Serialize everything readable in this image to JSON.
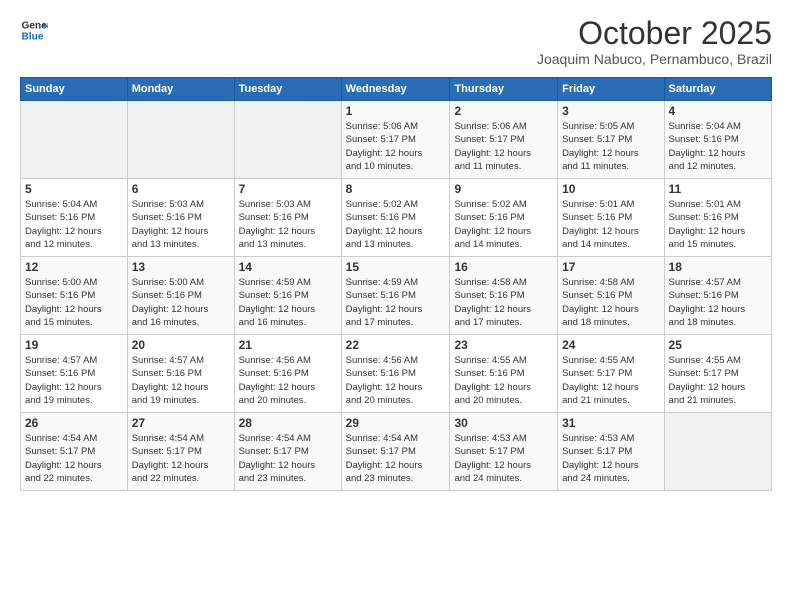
{
  "logo": {
    "line1": "General",
    "line2": "Blue"
  },
  "title": "October 2025",
  "subtitle": "Joaquim Nabuco, Pernambuco, Brazil",
  "days_header": [
    "Sunday",
    "Monday",
    "Tuesday",
    "Wednesday",
    "Thursday",
    "Friday",
    "Saturday"
  ],
  "weeks": [
    [
      {
        "day": "",
        "info": ""
      },
      {
        "day": "",
        "info": ""
      },
      {
        "day": "",
        "info": ""
      },
      {
        "day": "1",
        "info": "Sunrise: 5:06 AM\nSunset: 5:17 PM\nDaylight: 12 hours\nand 10 minutes."
      },
      {
        "day": "2",
        "info": "Sunrise: 5:06 AM\nSunset: 5:17 PM\nDaylight: 12 hours\nand 11 minutes."
      },
      {
        "day": "3",
        "info": "Sunrise: 5:05 AM\nSunset: 5:17 PM\nDaylight: 12 hours\nand 11 minutes."
      },
      {
        "day": "4",
        "info": "Sunrise: 5:04 AM\nSunset: 5:16 PM\nDaylight: 12 hours\nand 12 minutes."
      }
    ],
    [
      {
        "day": "5",
        "info": "Sunrise: 5:04 AM\nSunset: 5:16 PM\nDaylight: 12 hours\nand 12 minutes."
      },
      {
        "day": "6",
        "info": "Sunrise: 5:03 AM\nSunset: 5:16 PM\nDaylight: 12 hours\nand 13 minutes."
      },
      {
        "day": "7",
        "info": "Sunrise: 5:03 AM\nSunset: 5:16 PM\nDaylight: 12 hours\nand 13 minutes."
      },
      {
        "day": "8",
        "info": "Sunrise: 5:02 AM\nSunset: 5:16 PM\nDaylight: 12 hours\nand 13 minutes."
      },
      {
        "day": "9",
        "info": "Sunrise: 5:02 AM\nSunset: 5:16 PM\nDaylight: 12 hours\nand 14 minutes."
      },
      {
        "day": "10",
        "info": "Sunrise: 5:01 AM\nSunset: 5:16 PM\nDaylight: 12 hours\nand 14 minutes."
      },
      {
        "day": "11",
        "info": "Sunrise: 5:01 AM\nSunset: 5:16 PM\nDaylight: 12 hours\nand 15 minutes."
      }
    ],
    [
      {
        "day": "12",
        "info": "Sunrise: 5:00 AM\nSunset: 5:16 PM\nDaylight: 12 hours\nand 15 minutes."
      },
      {
        "day": "13",
        "info": "Sunrise: 5:00 AM\nSunset: 5:16 PM\nDaylight: 12 hours\nand 16 minutes."
      },
      {
        "day": "14",
        "info": "Sunrise: 4:59 AM\nSunset: 5:16 PM\nDaylight: 12 hours\nand 16 minutes."
      },
      {
        "day": "15",
        "info": "Sunrise: 4:59 AM\nSunset: 5:16 PM\nDaylight: 12 hours\nand 17 minutes."
      },
      {
        "day": "16",
        "info": "Sunrise: 4:58 AM\nSunset: 5:16 PM\nDaylight: 12 hours\nand 17 minutes."
      },
      {
        "day": "17",
        "info": "Sunrise: 4:58 AM\nSunset: 5:16 PM\nDaylight: 12 hours\nand 18 minutes."
      },
      {
        "day": "18",
        "info": "Sunrise: 4:57 AM\nSunset: 5:16 PM\nDaylight: 12 hours\nand 18 minutes."
      }
    ],
    [
      {
        "day": "19",
        "info": "Sunrise: 4:57 AM\nSunset: 5:16 PM\nDaylight: 12 hours\nand 19 minutes."
      },
      {
        "day": "20",
        "info": "Sunrise: 4:57 AM\nSunset: 5:16 PM\nDaylight: 12 hours\nand 19 minutes."
      },
      {
        "day": "21",
        "info": "Sunrise: 4:56 AM\nSunset: 5:16 PM\nDaylight: 12 hours\nand 20 minutes."
      },
      {
        "day": "22",
        "info": "Sunrise: 4:56 AM\nSunset: 5:16 PM\nDaylight: 12 hours\nand 20 minutes."
      },
      {
        "day": "23",
        "info": "Sunrise: 4:55 AM\nSunset: 5:16 PM\nDaylight: 12 hours\nand 20 minutes."
      },
      {
        "day": "24",
        "info": "Sunrise: 4:55 AM\nSunset: 5:17 PM\nDaylight: 12 hours\nand 21 minutes."
      },
      {
        "day": "25",
        "info": "Sunrise: 4:55 AM\nSunset: 5:17 PM\nDaylight: 12 hours\nand 21 minutes."
      }
    ],
    [
      {
        "day": "26",
        "info": "Sunrise: 4:54 AM\nSunset: 5:17 PM\nDaylight: 12 hours\nand 22 minutes."
      },
      {
        "day": "27",
        "info": "Sunrise: 4:54 AM\nSunset: 5:17 PM\nDaylight: 12 hours\nand 22 minutes."
      },
      {
        "day": "28",
        "info": "Sunrise: 4:54 AM\nSunset: 5:17 PM\nDaylight: 12 hours\nand 23 minutes."
      },
      {
        "day": "29",
        "info": "Sunrise: 4:54 AM\nSunset: 5:17 PM\nDaylight: 12 hours\nand 23 minutes."
      },
      {
        "day": "30",
        "info": "Sunrise: 4:53 AM\nSunset: 5:17 PM\nDaylight: 12 hours\nand 24 minutes."
      },
      {
        "day": "31",
        "info": "Sunrise: 4:53 AM\nSunset: 5:17 PM\nDaylight: 12 hours\nand 24 minutes."
      },
      {
        "day": "",
        "info": ""
      }
    ]
  ]
}
